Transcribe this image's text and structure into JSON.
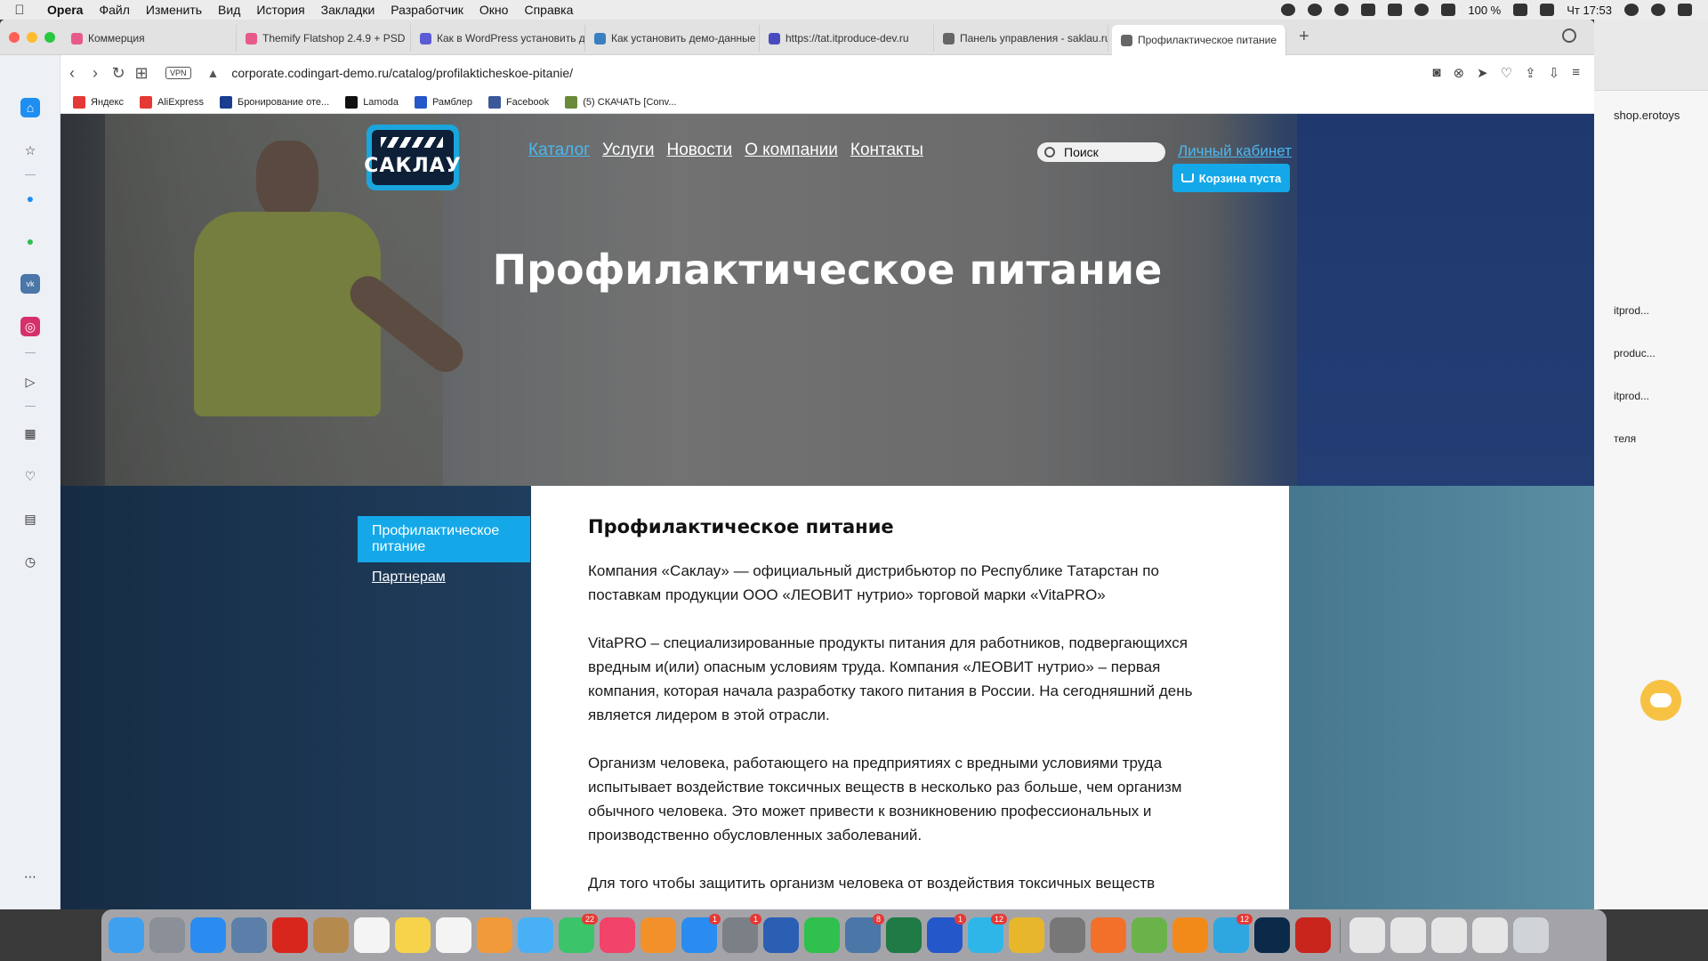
{
  "menubar": {
    "app": "Opera",
    "items": [
      "Файл",
      "Изменить",
      "Вид",
      "История",
      "Закладки",
      "Разработчик",
      "Окно",
      "Справка"
    ],
    "battery": "100 %",
    "clock": "Чт 17:53"
  },
  "tabs": [
    {
      "label": "Коммерция",
      "color": "#e85a8a"
    },
    {
      "label": "Themify Flatshop 2.4.9 + PSD",
      "color": "#e85a8a"
    },
    {
      "label": "Как в WordPress установить д",
      "color": "#5b5bd6"
    },
    {
      "label": "Как установить демо-данные",
      "color": "#3a7fc0"
    },
    {
      "label": "https://tat.itproduce-dev.ru",
      "color": "#4a4ac0"
    },
    {
      "label": "Панель управления - saklau.ru",
      "color": "#666666"
    },
    {
      "label": "Профилактическое питание",
      "color": "#666666"
    }
  ],
  "address": {
    "vpn": "VPN",
    "url": "corporate.codingart-demo.ru/catalog/profilakticheskoe-pitanie/"
  },
  "bookmarks": [
    {
      "label": "Яндекс",
      "color": "#e53935"
    },
    {
      "label": "AliExpress",
      "color": "#e53935"
    },
    {
      "label": "Бронирование оте...",
      "color": "#1a3d8f"
    },
    {
      "label": "Lamoda",
      "color": "#111111"
    },
    {
      "label": "Рамблер",
      "color": "#2457c9"
    },
    {
      "label": "Facebook",
      "color": "#3b5998"
    },
    {
      "label": "(5) СКАЧАТЬ [Conv...",
      "color": "#6a8a3a"
    }
  ],
  "site": {
    "logo_text": "САКЛАУ",
    "nav": [
      {
        "label": "Каталог",
        "active": true
      },
      {
        "label": "Услуги",
        "active": false
      },
      {
        "label": "Новости",
        "active": false
      },
      {
        "label": "О компании",
        "active": false
      },
      {
        "label": "Контакты",
        "active": false
      }
    ],
    "search_placeholder": "Поиск",
    "cabinet": "Личный кабинет",
    "cart": "Корзина пуста",
    "hero_title": "Профилактическое питание",
    "side_menu": [
      {
        "label": "Профилактическое питание",
        "active": true
      },
      {
        "label": "Партнерам",
        "active": false
      }
    ],
    "article": {
      "heading": "Профилактическое питание",
      "paragraphs": [
        "Компания «Саклау» — официальный дистрибьютор по Республике Татарстан по поставкам продукции ООО «ЛЕОВИТ нутрио» торговой марки «VitaPRO»",
        "VitaPRO – специализированные продукты питания для работников, подвергающихся вредным и(или) опасным условиям труда. Компания «ЛЕОВИТ нутрио» – первая компания, которая начала разработку такого питания в России. На сегодняшний день является лидером в этой отрасли.",
        "Организм человека, работающего на предприятиях с вредными условиями труда испытывает воздействие токсичных веществ в несколько раз больше, чем организм обычного человека. Это может привести к возникновению профессиональных и производственно обусловленных заболеваний.",
        "Для того чтобы защитить организм человека от воздействия токсичных веществ"
      ]
    }
  },
  "bg_window": {
    "shop": "shop.erotoys",
    "lines": [
      "itprod...",
      "produc...",
      "itprod...",
      "теля"
    ]
  },
  "dock": {
    "apps": [
      {
        "name": "finder",
        "color": "#3fa0f0",
        "badge": ""
      },
      {
        "name": "launchpad",
        "color": "#8a8f98",
        "badge": ""
      },
      {
        "name": "safari",
        "color": "#2a8cf0",
        "badge": ""
      },
      {
        "name": "mail-stamp",
        "color": "#5b7fa8",
        "badge": ""
      },
      {
        "name": "opera",
        "color": "#d8261c",
        "badge": ""
      },
      {
        "name": "notes-brown",
        "color": "#b58a4f",
        "badge": ""
      },
      {
        "name": "calendar",
        "color": "#f4f4f4",
        "badge": ""
      },
      {
        "name": "notes",
        "color": "#f7d24b",
        "badge": ""
      },
      {
        "name": "reminders",
        "color": "#f4f4f4",
        "badge": ""
      },
      {
        "name": "photos",
        "color": "#f09a3a",
        "badge": ""
      },
      {
        "name": "messages",
        "color": "#4ab0f5",
        "badge": ""
      },
      {
        "name": "facetime",
        "color": "#3cc46a",
        "badge": "22"
      },
      {
        "name": "music",
        "color": "#f2436a",
        "badge": ""
      },
      {
        "name": "books",
        "color": "#f2902a",
        "badge": ""
      },
      {
        "name": "app-store",
        "color": "#2a8cf0",
        "badge": "1"
      },
      {
        "name": "system-preferences",
        "color": "#7b7f86",
        "badge": "1"
      },
      {
        "name": "word",
        "color": "#2b5fb4",
        "badge": ""
      },
      {
        "name": "whatsapp",
        "color": "#2fc04d",
        "badge": ""
      },
      {
        "name": "vk",
        "color": "#4a76a8",
        "badge": "8"
      },
      {
        "name": "excel",
        "color": "#1f7a45",
        "badge": ""
      },
      {
        "name": "feather",
        "color": "#2457c9",
        "badge": "1"
      },
      {
        "name": "bitrix24",
        "color": "#2fb6e8",
        "badge": "12"
      },
      {
        "name": "chrome",
        "color": "#e8b62a",
        "badge": ""
      },
      {
        "name": "disk-utility",
        "color": "#777777",
        "badge": ""
      },
      {
        "name": "firefox",
        "color": "#f2702a",
        "badge": ""
      },
      {
        "name": "utorrent",
        "color": "#6ab24a",
        "badge": ""
      },
      {
        "name": "vlc",
        "color": "#f28a1a",
        "badge": ""
      },
      {
        "name": "telegram",
        "color": "#2ea6e0",
        "badge": "12"
      },
      {
        "name": "photoshop",
        "color": "#0b2a4a",
        "badge": ""
      },
      {
        "name": "filezilla",
        "color": "#c8261c",
        "badge": ""
      },
      {
        "name": "files-1",
        "color": "#e6e6e6",
        "badge": ""
      },
      {
        "name": "files-2",
        "color": "#e6e6e6",
        "badge": ""
      },
      {
        "name": "files-3",
        "color": "#e6e6e6",
        "badge": ""
      },
      {
        "name": "files-4",
        "color": "#e6e6e6",
        "badge": ""
      },
      {
        "name": "trash",
        "color": "#d0d4d8",
        "badge": ""
      }
    ]
  }
}
